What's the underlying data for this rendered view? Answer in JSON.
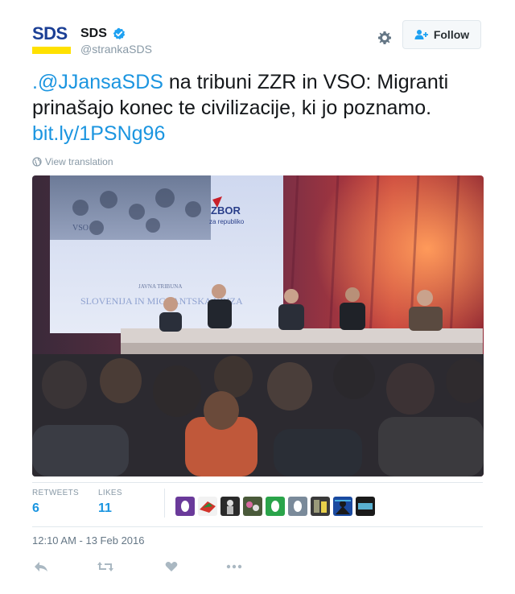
{
  "account": {
    "logo_text": "SDS",
    "display_name": "SDS",
    "handle": "@strankaSDS",
    "follow_label": "Follow"
  },
  "tweet": {
    "mention": ".@JJansaSDS",
    "body": " na tribuni ZZR in VSO: Migranti prinašajo konec te civilizacije, ki jo poznamo. ",
    "link": "bit.ly/1PSNg96",
    "translate_label": "View translation",
    "timestamp": "12:10 AM - 13 Feb 2016"
  },
  "stats": {
    "retweets_label": "RETWEETS",
    "retweets": "6",
    "likes_label": "LIKES",
    "likes": "11"
  },
  "photo": {
    "screen_logo_line1": "ZBOR",
    "screen_logo_line2": "za republiko",
    "screen_vso": "VSO",
    "screen_subtitle": "JAVNA TRIBUNA",
    "screen_title": "SLOVENIJA IN MIGRANTSKA KRIZA"
  },
  "colors": {
    "link": "#1b95e0",
    "muted": "#8899a6",
    "logo_blue": "#1b3f95",
    "logo_yellow": "#ffe100"
  },
  "icons": [
    "verified-icon",
    "gear-icon",
    "follow-person-icon",
    "globe-icon",
    "reply-icon",
    "retweet-icon",
    "like-icon",
    "more-icon"
  ]
}
